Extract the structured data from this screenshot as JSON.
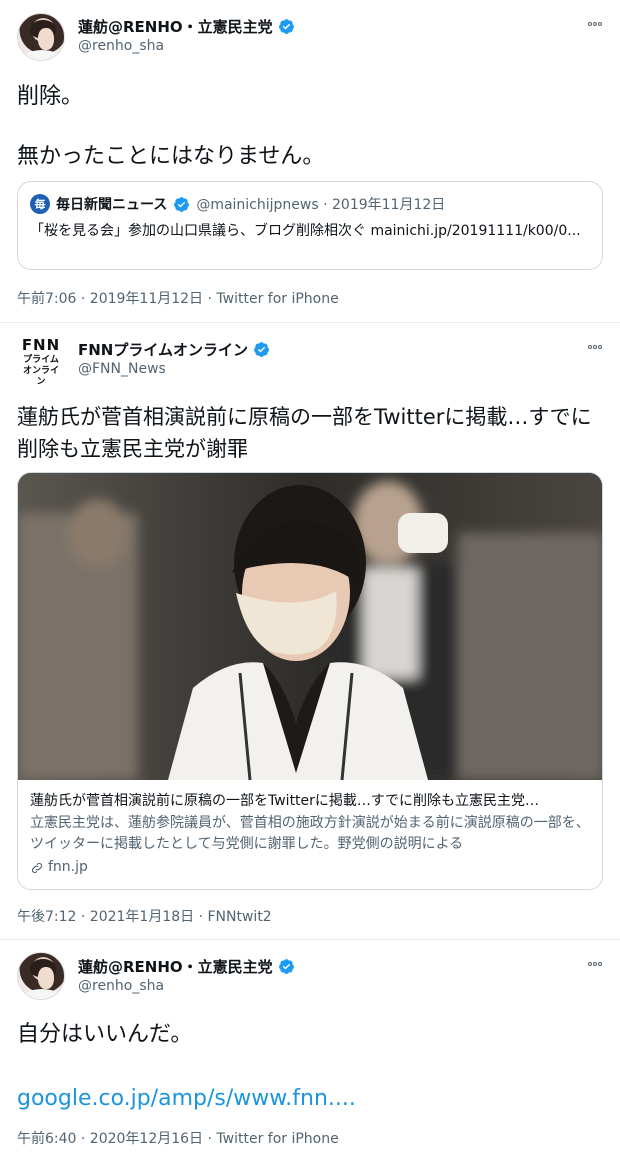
{
  "tweets": [
    {
      "display_name": "蓮舫@RENHO・立憲民主党",
      "handle": "@renho_sha",
      "text_line1": "削除。",
      "text_line2": "無かったことにはなりません。",
      "quote": {
        "name": "毎日新聞ニュース",
        "handle": "@mainichijpnews · 2019年11月12日",
        "text": "「桜を見る会」参加の山口県議ら、ブログ削除相次ぐ mainichi.jp/20191111/k00/0..."
      },
      "meta": "午前7:06 · 2019年11月12日 · Twitter for iPhone"
    },
    {
      "display_name": "FNNプライムオンライン",
      "handle": "@FNN_News",
      "logo_main": "FNN",
      "logo_sub1": "プライム",
      "logo_sub2": "オンライン",
      "text": "蓮舫氏が菅首相演説前に原稿の一部をTwitterに掲載…すでに削除も立憲民主党が謝罪",
      "card": {
        "title": "蓮舫氏が菅首相演説前に原稿の一部をTwitterに掲載…すでに削除も立憲民主党…",
        "description": "立憲民主党は、蓮舫参院議員が、菅首相の施政方針演説が始まる前に演説原稿の一部を、ツイッターに掲載したとして与党側に謝罪した。野党側の説明による",
        "domain": "fnn.jp"
      },
      "meta": "午後7:12 · 2021年1月18日 · FNNtwit2"
    },
    {
      "display_name": "蓮舫@RENHO・立憲民主党",
      "handle": "@renho_sha",
      "text": "自分はいいんだ。",
      "link": "google.co.jp/amp/s/www.fnn....",
      "meta": "午前6:40 · 2020年12月16日 · Twitter for iPhone"
    }
  ],
  "colors": {
    "verified": "#1d9bf0",
    "link": "#1b95e0",
    "secondary_text": "#536471",
    "border": "#cfd9de"
  },
  "icons": [
    "verified-badge-icon",
    "more-options-icon",
    "link-icon"
  ]
}
